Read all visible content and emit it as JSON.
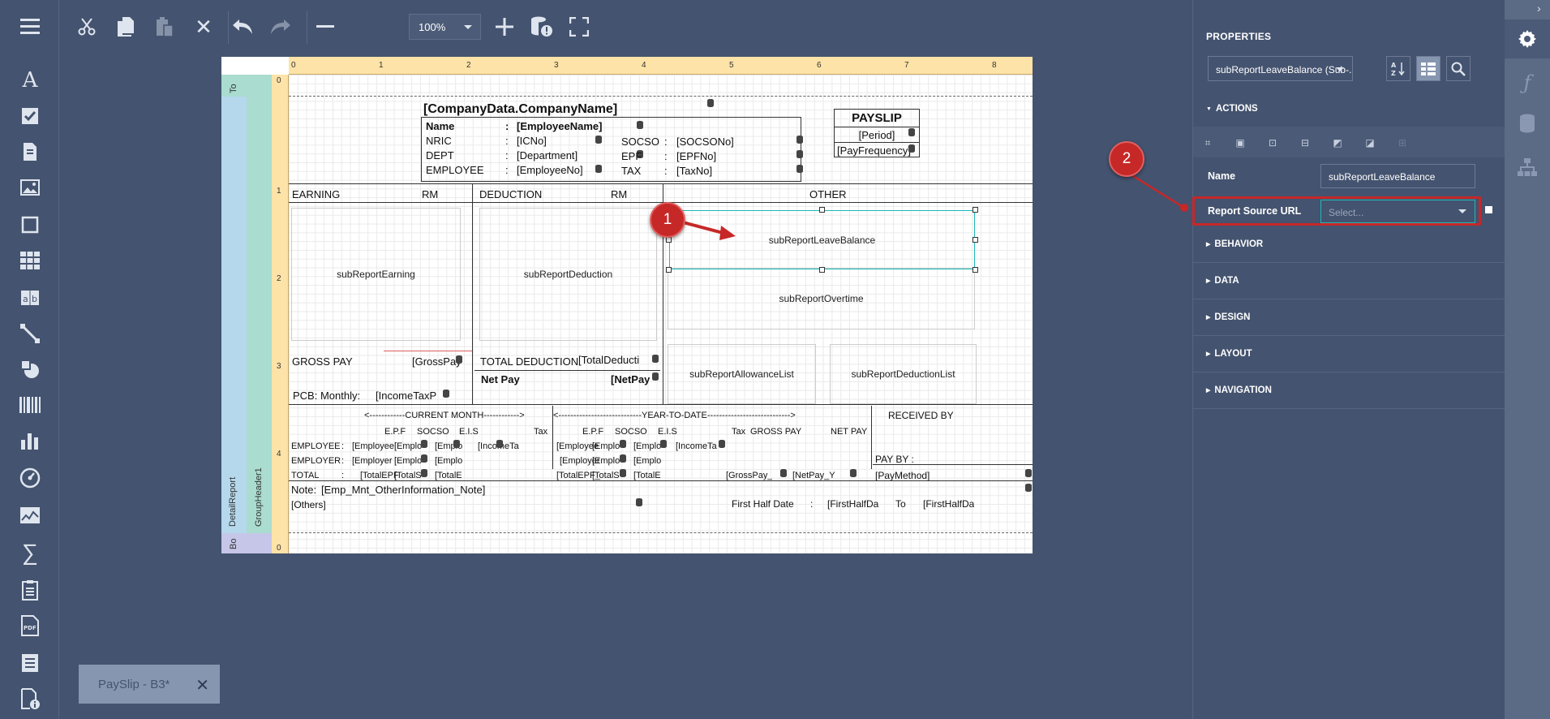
{
  "toolbar": {
    "zoom": "100%",
    "buttons": [
      "menu",
      "cut",
      "copy",
      "paste",
      "delete",
      "undo",
      "redo",
      "zoom-out",
      "zoom-in",
      "validate-bindings",
      "fullscreen"
    ]
  },
  "left_toolbar": [
    "label",
    "checkbox",
    "rich-text",
    "picture",
    "panel",
    "table",
    "character-comb",
    "line",
    "shape",
    "barcode",
    "chart",
    "gauge",
    "sparkline",
    "summary",
    "subreport",
    "pdf-content",
    "table-of-contents",
    "page-info"
  ],
  "bands": {
    "top": "To",
    "detail_report": "DetailReport",
    "group_header": "GroupHeader1",
    "bottom": "Bo"
  },
  "ruler": {
    "top": [
      "0",
      "1",
      "2",
      "3",
      "4",
      "5",
      "6",
      "7",
      "8"
    ],
    "left": [
      "0",
      "1",
      "2",
      "3",
      "4",
      "0"
    ]
  },
  "report": {
    "company": "[CompanyData.CompanyName]",
    "payslip_title": "PAYSLIP",
    "period": "[Period]",
    "pay_frequency": "[PayFrequency]",
    "emp_labels": [
      "Name",
      "NRIC",
      "DEPT",
      "EMPLOYEE"
    ],
    "colon": ":",
    "emp_values": [
      "[EmployeeName]",
      "[ICNo]",
      "[Department]",
      "[EmployeeNo]"
    ],
    "stat_labels": [
      "SOCSO",
      "EPF",
      "TAX"
    ],
    "stat_values": [
      "[SOCSONo]",
      "[EPFNo]",
      "[TaxNo]"
    ],
    "earning": "EARNING",
    "rm": "RM",
    "deduction": "DEDUCTION",
    "other": "OTHER",
    "sub_earning": "subReportEarning",
    "sub_deduction": "subReportDeduction",
    "sub_leave": "subReportLeaveBalance",
    "sub_overtime": "subReportOvertime",
    "sub_allowance": "subReportAllowanceList",
    "sub_deduction_list": "subReportDeductionList",
    "gross_pay": "GROSS PAY",
    "gross_pay_val": "[GrossPay",
    "total_deduction": "TOTAL DEDUCTION",
    "total_deduction_val": "[TotalDeducti",
    "net_pay": "Net Pay",
    "net_pay_val": "[NetPay",
    "pcb": "PCB: Monthly:",
    "pcb_val": "[IncomeTaxP",
    "current_month": "<------------CURRENT MONTH------------>",
    "ytd": "<----------------------------YEAR-TO-DATE---------------------------->",
    "received_by": "RECEIVED BY",
    "col_heads": [
      "E.P.F",
      "SOCSO",
      "E.I.S",
      "Tax"
    ],
    "gross_pay_head": "GROSS PAY",
    "net_pay_head": "NET PAY",
    "row_labels": [
      "EMPLOYEE",
      "EMPLOYER",
      "TOTAL"
    ],
    "row1": [
      "[Employee",
      "[Emplo",
      "[Emplo",
      "[IncomeTa"
    ],
    "row2": [
      "[Employer",
      "[Emplo",
      "[Emplo"
    ],
    "row3": [
      "[TotalEPF",
      "[TotalS",
      "[TotalE"
    ],
    "row1_ytd": [
      "[Employee",
      "[Emplo",
      "[Emplo",
      "[IncomeTa"
    ],
    "row2_ytd": [
      "[Employer",
      "[Emplo",
      "[Emplo"
    ],
    "row3_ytd": [
      "[TotalEPF_",
      "[TotalS",
      "[TotalE"
    ],
    "ytd_gross": "[GrossPay_",
    "ytd_net": "[NetPay_Y",
    "pay_by": "PAY BY :",
    "pay_method": "[PayMethod]",
    "note": "Note:",
    "note_val": "[Emp_Mnt_OtherInformation_Note]",
    "others": "[Others]",
    "first_half": "First Half Date",
    "first_half_val": "[FirstHalfDa",
    "to": "To",
    "first_half_val2": "[FirstHalfDa"
  },
  "doc_tab": {
    "label": "PaySlip - B3*",
    "close": "✕"
  },
  "properties": {
    "title": "PROPERTIES",
    "component": "subReportLeaveBalance (Sub-...",
    "sections": {
      "actions": "ACTIONS",
      "behavior": "BEHAVIOR",
      "data": "DATA",
      "design": "DESIGN",
      "layout": "LAYOUT",
      "navigation": "NAVIGATION"
    },
    "name_label": "Name",
    "name_value": "subReportLeaveBalance",
    "rsu_label": "Report Source URL",
    "rsu_placeholder": "Select..."
  },
  "callouts": {
    "one": "1",
    "two": "2"
  },
  "colors": {
    "callout": "#c62828",
    "selection": "#1fb8b8",
    "panel": "#44536f"
  }
}
